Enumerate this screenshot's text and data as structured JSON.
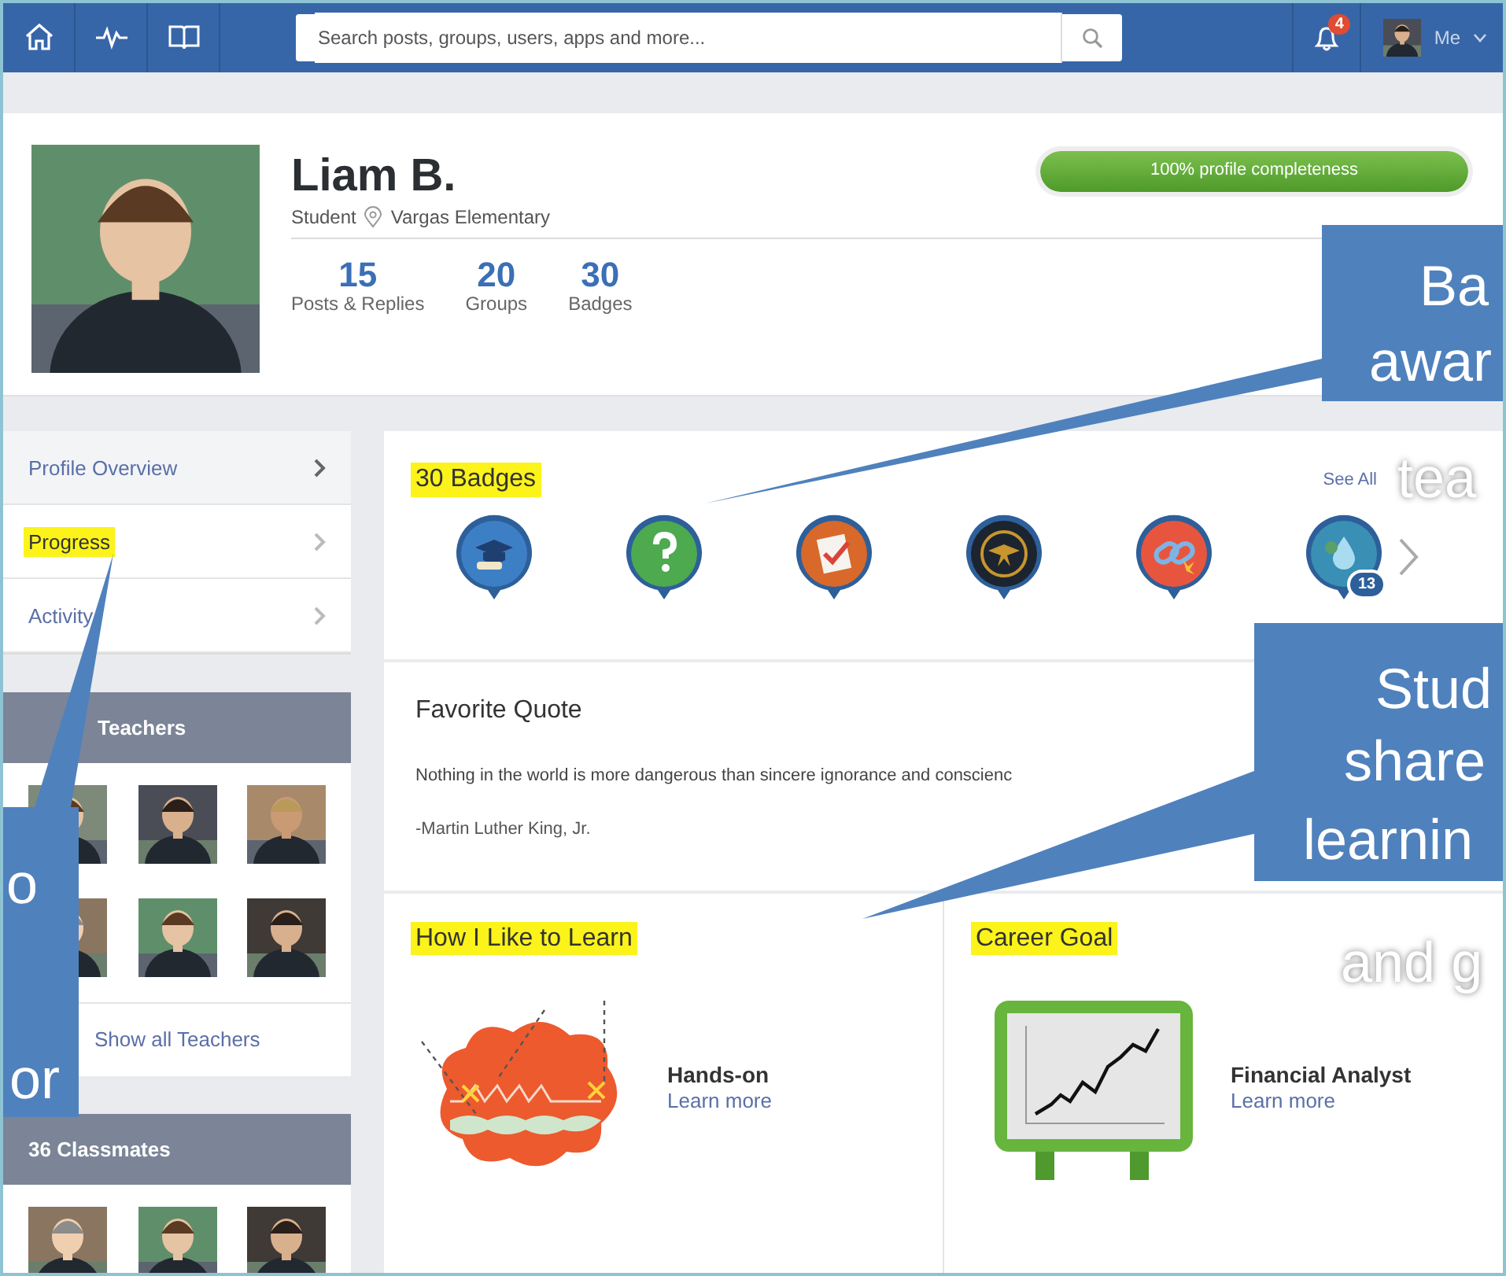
{
  "search": {
    "placeholder": "Search posts, groups, users, apps and more..."
  },
  "notifications": {
    "count": "4"
  },
  "user_menu": {
    "label": "Me"
  },
  "profile": {
    "name": "Liam B.",
    "role": "Student",
    "school": "Vargas Elementary",
    "stats": [
      {
        "value": "15",
        "label": "Posts & Replies"
      },
      {
        "value": "20",
        "label": "Groups"
      },
      {
        "value": "30",
        "label": "Badges"
      }
    ],
    "completeness": {
      "label": "100% profile completeness",
      "level": 1
    }
  },
  "sidebar": {
    "items": [
      {
        "label": "Profile Overview",
        "selected": true,
        "highlighted": false
      },
      {
        "label": "Progress",
        "selected": false,
        "highlighted": true
      },
      {
        "label": "Activity",
        "selected": false,
        "highlighted": false
      }
    ]
  },
  "teachers": {
    "title": "Teachers",
    "link": "Show all Teachers"
  },
  "classmates": {
    "title": "36 Classmates"
  },
  "badges": {
    "title": "30 Badges",
    "highlighted": true,
    "see_all": "See All",
    "items": [
      {
        "kind": "graduation"
      },
      {
        "kind": "question"
      },
      {
        "kind": "checklist"
      },
      {
        "kind": "bird"
      },
      {
        "kind": "chain"
      },
      {
        "kind": "water",
        "count": "13"
      }
    ]
  },
  "quote": {
    "title": "Favorite Quote",
    "text": "Nothing in the world is more dangerous than sincere ignorance and conscienc",
    "author": "-Martin Luther King, Jr."
  },
  "learning": {
    "title": "How I Like to Learn",
    "highlighted": true,
    "style": "Hands-on",
    "link": "Learn more"
  },
  "career": {
    "title": "Career Goal",
    "highlighted": true,
    "goal": "Financial Analyst",
    "link": "Learn more"
  },
  "callouts": [
    {
      "lines": [
        "Ba",
        "awar",
        "tea"
      ]
    },
    {
      "lines": [
        "Stud",
        "share",
        "learnin",
        "and g"
      ]
    },
    {
      "lines": [
        "o",
        "or"
      ]
    }
  ]
}
